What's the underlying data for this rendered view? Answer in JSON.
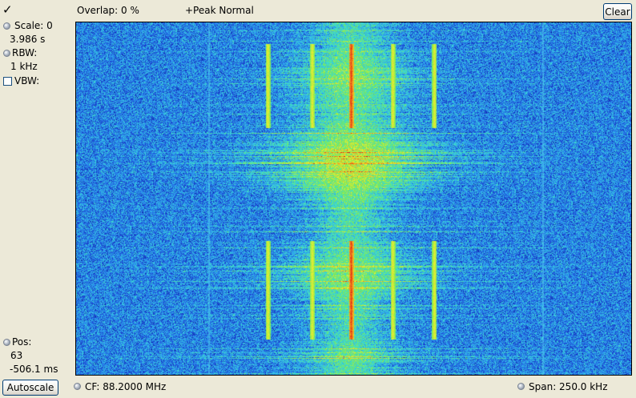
{
  "toolbar": {
    "check_glyph": "✓",
    "overlap_label": "Overlap: 0 %",
    "trace_mode": "+Peak Normal",
    "clear_label": "Clear"
  },
  "left_panel": {
    "scale_label": "Scale: 0",
    "scale_value": "3.986 s",
    "rbw_label": "RBW:",
    "rbw_value": "1 kHz",
    "vbw_label": "VBW:",
    "vbw_checked": false,
    "pos_label": "Pos:",
    "pos_value": "63",
    "pos_time": "-506.1 ms",
    "autoscale_label": "Autoscale"
  },
  "footer": {
    "cf_label": "CF: 88.2000 MHz",
    "span_label": "Span: 250.0 kHz"
  },
  "waterfall": {
    "center_frequency_mhz": 88.2,
    "span_khz": 250.0,
    "colormap": [
      "#0a1a9c",
      "#1e4fd8",
      "#2fa8f0",
      "#3fe0c8",
      "#7ae858",
      "#e8f030",
      "#f0a020",
      "#e01010"
    ]
  }
}
